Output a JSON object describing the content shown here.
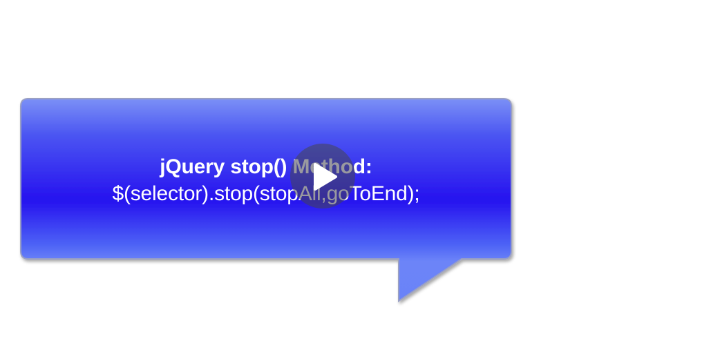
{
  "slide": {
    "title": "jQuery stop() Method:",
    "syntax": "$(selector).stop(stopAll,goToEnd);"
  },
  "player": {
    "play_icon": "play-icon"
  },
  "colors": {
    "bubble_top": "#6f86f7",
    "bubble_mid": "#2a18ef",
    "bubble_bottom": "#6b83f8",
    "bubble_border": "#8a8fb0",
    "text": "#ffffff"
  }
}
